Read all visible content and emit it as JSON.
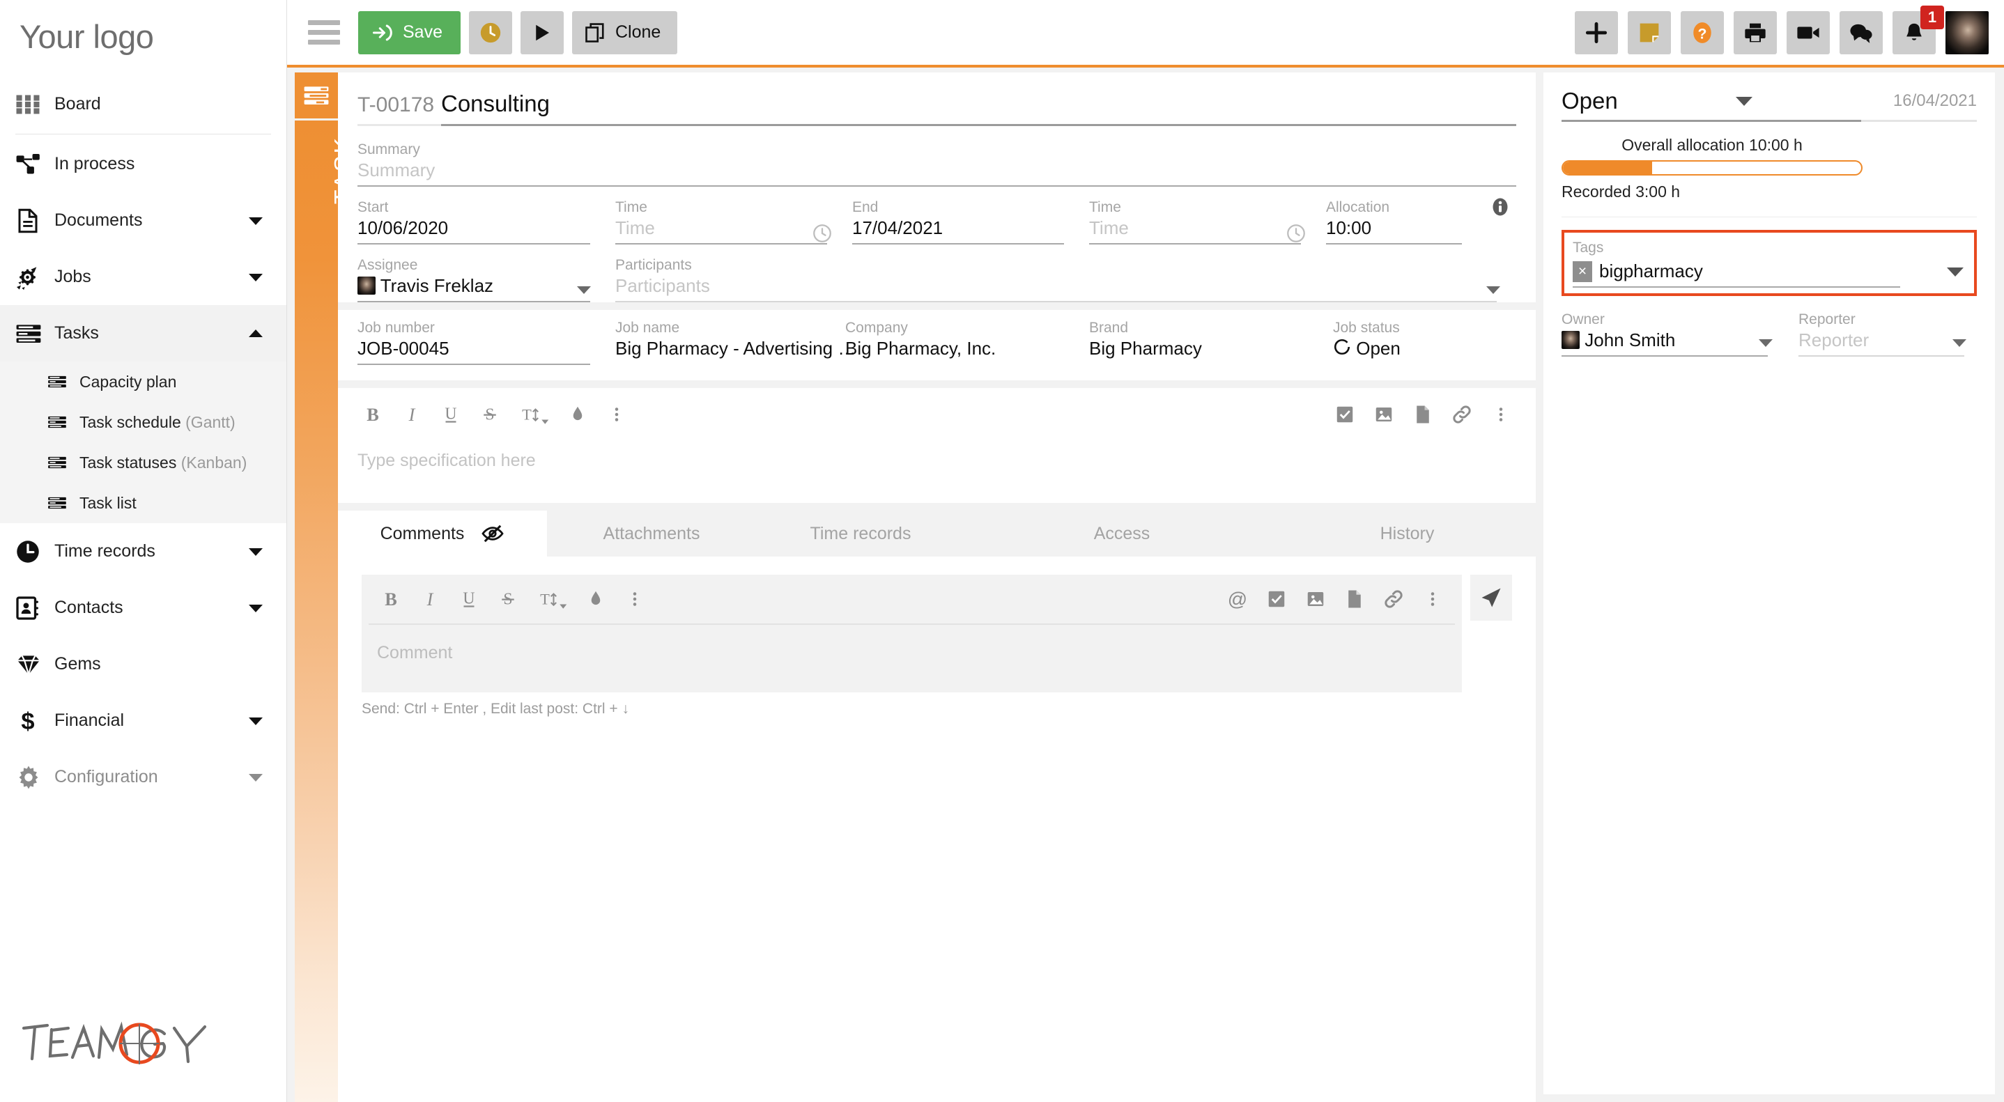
{
  "brand": {
    "logo_text": "Your logo",
    "product_logo": "TEAMOGY",
    "accent": "#ee8f33",
    "save_green": "#58b05a",
    "alert_red": "#d0241f",
    "highlight_red": "#e8491f"
  },
  "sidebar": {
    "items": [
      {
        "label": "Board",
        "icon": "grid-icon",
        "expandable": false
      },
      {
        "label": "In process",
        "icon": "workflow-icon",
        "expandable": false
      },
      {
        "label": "Documents",
        "icon": "document-icon",
        "expandable": true
      },
      {
        "label": "Jobs",
        "icon": "rocket-gear-icon",
        "expandable": true
      },
      {
        "label": "Tasks",
        "icon": "list-icon",
        "expandable": true,
        "expanded": true
      },
      {
        "label": "Time records",
        "icon": "clock-icon",
        "expandable": true
      },
      {
        "label": "Contacts",
        "icon": "contacts-icon",
        "expandable": true
      },
      {
        "label": "Gems",
        "icon": "gem-icon",
        "expandable": false
      },
      {
        "label": "Financial",
        "icon": "dollar-icon",
        "expandable": true
      },
      {
        "label": "Configuration",
        "icon": "gear-icon",
        "expandable": true,
        "muted": true
      }
    ],
    "tasks_subitems": [
      {
        "label": "Capacity plan",
        "sub": ""
      },
      {
        "label": "Task schedule ",
        "sub": "(Gantt)"
      },
      {
        "label": "Task statuses ",
        "sub": "(Kanban)"
      },
      {
        "label": "Task list",
        "sub": ""
      }
    ]
  },
  "toolbar": {
    "menu_icon": "hamburger-icon",
    "save_label": "Save",
    "timer_icon": "clock-icon",
    "play_icon": "play-icon",
    "clone_label": "Clone",
    "right_icons": [
      {
        "name": "add-icon",
        "glyph": "+"
      },
      {
        "name": "note-icon",
        "glyph": "note"
      },
      {
        "name": "help-icon",
        "glyph": "?"
      },
      {
        "name": "print-icon",
        "glyph": "print"
      },
      {
        "name": "video-icon",
        "glyph": "video"
      },
      {
        "name": "chat-icon",
        "glyph": "chat"
      },
      {
        "name": "bell-icon",
        "glyph": "bell",
        "badge": "1"
      }
    ]
  },
  "task": {
    "strip_label": "TASK",
    "id": "T-00178",
    "title": "Consulting",
    "summary": {
      "label": "Summary",
      "placeholder": "Summary",
      "value": ""
    },
    "start": {
      "label": "Start",
      "value": "10/06/2020"
    },
    "start_time": {
      "label": "Time",
      "placeholder": "Time",
      "value": ""
    },
    "end": {
      "label": "End",
      "value": "17/04/2021"
    },
    "end_time": {
      "label": "Time",
      "placeholder": "Time",
      "value": ""
    },
    "allocation": {
      "label": "Allocation",
      "value": "10:00"
    },
    "assignee": {
      "label": "Assignee",
      "value": "Travis Freklaz"
    },
    "participants": {
      "label": "Participants",
      "placeholder": "Participants",
      "value": ""
    },
    "job_number": {
      "label": "Job number",
      "value": "JOB-00045"
    },
    "job_name": {
      "label": "Job name",
      "value": "Big Pharmacy - Advertising …"
    },
    "company": {
      "label": "Company",
      "value": "Big Pharmacy, Inc."
    },
    "brand": {
      "label": "Brand",
      "value": "Big Pharmacy"
    },
    "job_status": {
      "label": "Job status",
      "value": "Open"
    }
  },
  "spec_editor": {
    "placeholder": "Type specification here",
    "left_tools": [
      "bold-icon",
      "italic-icon",
      "underline-icon",
      "strikethrough-icon",
      "font-size-icon",
      "text-color-icon",
      "more-icon"
    ],
    "right_tools": [
      "checklist-icon",
      "image-icon",
      "file-icon",
      "link-icon",
      "more-icon"
    ]
  },
  "tabs": [
    {
      "label": "Comments",
      "active": true,
      "icon": "eye-off-icon"
    },
    {
      "label": "Attachments",
      "active": false
    },
    {
      "label": "Time records",
      "active": false
    },
    {
      "label": "Access",
      "active": false
    },
    {
      "label": "History",
      "active": false
    }
  ],
  "comment_editor": {
    "placeholder": "Comment",
    "hint": "Send: Ctrl + Enter , Edit last post: Ctrl + ↓",
    "left_tools": [
      "bold-icon",
      "italic-icon",
      "underline-icon",
      "strikethrough-icon",
      "font-size-icon",
      "text-color-icon",
      "more-icon"
    ],
    "right_tools": [
      "mention-icon",
      "checklist-icon",
      "image-icon",
      "file-icon",
      "link-icon",
      "more-icon"
    ],
    "send_icon": "send-icon"
  },
  "side_panel": {
    "status": "Open",
    "date": "16/04/2021",
    "allocation_title": "Overall allocation 10:00 h",
    "allocation_percent": 30,
    "recorded": "Recorded 3:00 h",
    "tags": {
      "label": "Tags",
      "chips": [
        {
          "name": "bigpharmacy",
          "remove": "×"
        }
      ]
    },
    "owner": {
      "label": "Owner",
      "value": "John Smith"
    },
    "reporter": {
      "label": "Reporter",
      "placeholder": "Reporter",
      "value": ""
    }
  }
}
